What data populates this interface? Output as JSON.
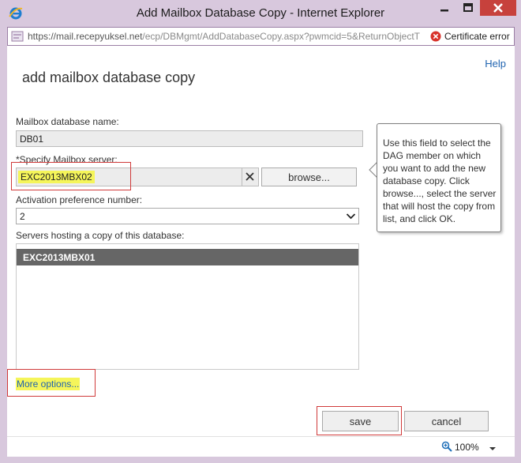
{
  "window": {
    "title": "Add Mailbox Database Copy - Internet Explorer"
  },
  "address_bar": {
    "url_host": "https://mail.recepyuksel.net",
    "url_path": "/ecp/DBMgmt/AddDatabaseCopy.aspx?pwmcid=5&ReturnObjectT",
    "certificate_status": "Certificate error"
  },
  "page": {
    "help_link": "Help",
    "title": "add mailbox database copy"
  },
  "form": {
    "database_name_label": "Mailbox database name:",
    "database_name_value": "DB01",
    "server_label": "*Specify Mailbox server:",
    "server_value": "EXC2013MBX02",
    "browse_label": "browse...",
    "activation_label": "Activation preference number:",
    "activation_value": "2",
    "servers_list_label": "Servers hosting a copy of this database:",
    "servers": [
      "EXC2013MBX01"
    ],
    "more_options": "More options..."
  },
  "callout": {
    "text": "Use this field to select the DAG member on which you want to add the new database copy. Click browse..., select the server that will host the copy from list, and click OK."
  },
  "actions": {
    "save_label": "save",
    "cancel_label": "cancel"
  },
  "statusbar": {
    "zoom_level": "100%"
  },
  "colors": {
    "frame": "#d8c8dd",
    "close_button": "#c7413c",
    "link": "#1f63b0",
    "highlight": "#f5f55a",
    "annotation_box": "#d03a3a",
    "selected_row": "#666666"
  },
  "icons": {
    "app": "internet-explorer-icon",
    "minimize": "minimize-icon",
    "maximize": "maximize-icon",
    "close": "close-icon",
    "certificate_error": "error-icon",
    "clear": "clear-x-icon",
    "dropdown": "chevron-down-icon",
    "zoom": "zoom-icon"
  }
}
